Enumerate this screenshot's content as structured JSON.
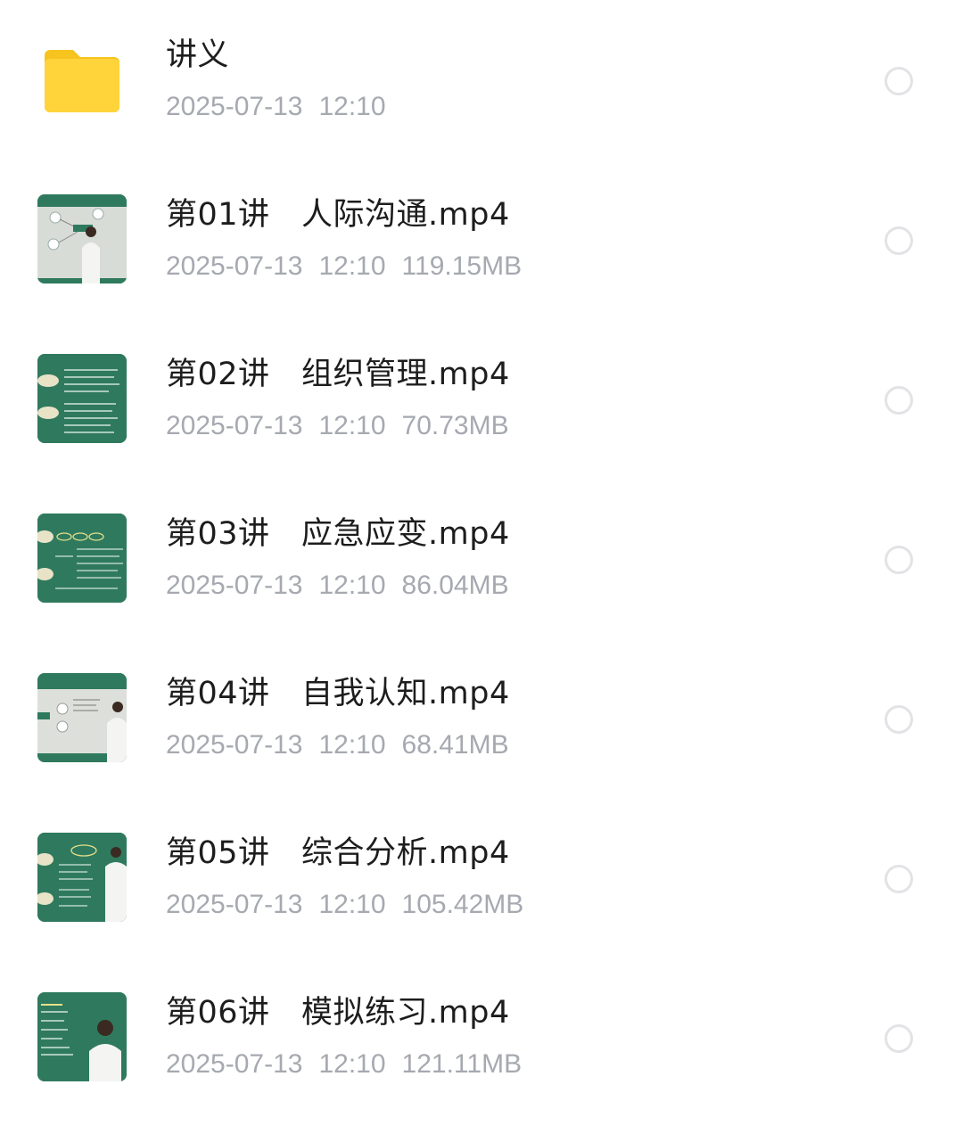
{
  "items": [
    {
      "type": "folder",
      "icon": "folder-icon",
      "name": "讲义",
      "date": "2025-07-13",
      "time": "12:10",
      "size": ""
    },
    {
      "type": "video",
      "icon": "video-thumbnail",
      "name": "第01讲　人际沟通.mp4",
      "date": "2025-07-13",
      "time": "12:10",
      "size": "119.15MB"
    },
    {
      "type": "video",
      "icon": "video-thumbnail",
      "name": "第02讲　组织管理.mp4",
      "date": "2025-07-13",
      "time": "12:10",
      "size": "70.73MB"
    },
    {
      "type": "video",
      "icon": "video-thumbnail",
      "name": "第03讲　应急应变.mp4",
      "date": "2025-07-13",
      "time": "12:10",
      "size": "86.04MB"
    },
    {
      "type": "video",
      "icon": "video-thumbnail",
      "name": "第04讲　自我认知.mp4",
      "date": "2025-07-13",
      "time": "12:10",
      "size": "68.41MB"
    },
    {
      "type": "video",
      "icon": "video-thumbnail",
      "name": "第05讲　综合分析.mp4",
      "date": "2025-07-13",
      "time": "12:10",
      "size": "105.42MB"
    },
    {
      "type": "video",
      "icon": "video-thumbnail",
      "name": "第06讲　模拟练习.mp4",
      "date": "2025-07-13",
      "time": "12:10",
      "size": "121.11MB"
    }
  ],
  "colors": {
    "folder": "#ffd43b",
    "thumbnail_green": "#2f7a5e",
    "meta_text": "#a6a9b0",
    "radio_border": "#e2e3e6"
  }
}
